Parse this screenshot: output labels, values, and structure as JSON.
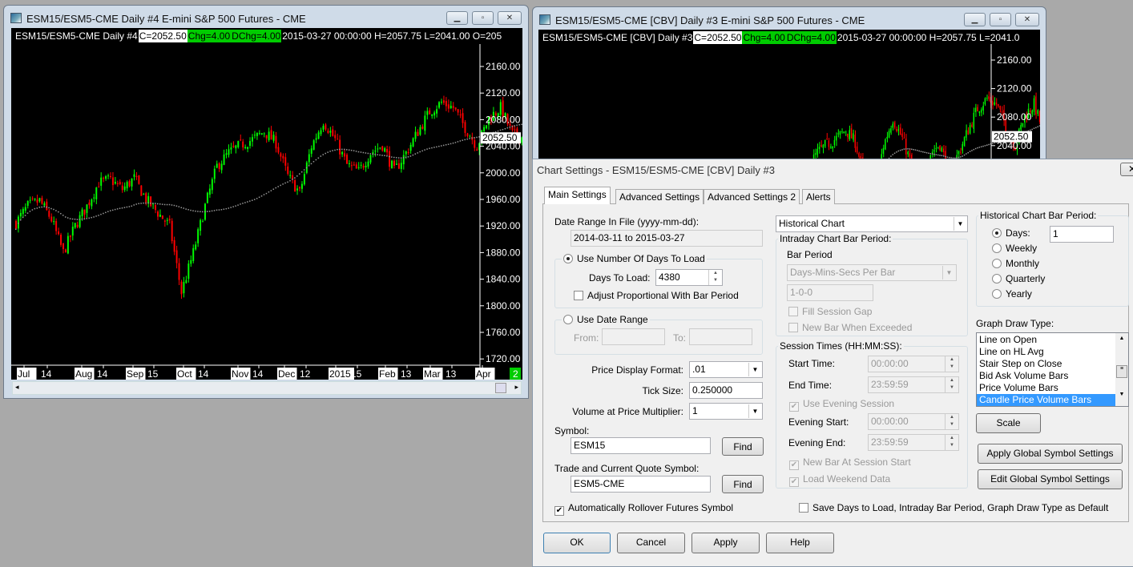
{
  "left_window": {
    "title": "ESM15/ESM5-CME  Daily  #4  E-mini S&P 500 Futures - CME",
    "header": {
      "symbol": "ESM15/ESM5-CME  Daily  #4",
      "close": "C=2052.50",
      "chg": "Chg=4.00",
      "dchg": "DChg=4.00",
      "rest": "2015-03-27 00:00:00 H=2057.75 L=2041.00 O=205"
    },
    "y_ticks": [
      "2160.00",
      "2120.00",
      "2080.00",
      "2040.00",
      "2000.00",
      "1960.00",
      "1920.00",
      "1880.00",
      "1840.00",
      "1800.00",
      "1760.00",
      "1720.00"
    ],
    "last_price": "2052.50",
    "x_ticks": [
      "Jul",
      "14",
      "Aug",
      "14",
      "Sep",
      "15",
      "Oct",
      "14",
      "Nov",
      "14",
      "Dec",
      "12",
      "2015",
      "15",
      "Feb",
      "13",
      "Mar",
      "13",
      "Apr"
    ],
    "corner_badge": "2"
  },
  "right_window": {
    "title": "ESM15/ESM5-CME [CBV]  Daily  #3  E-mini S&P 500 Futures - CME",
    "header": {
      "symbol": "ESM15/ESM5-CME [CBV]  Daily  #3",
      "close": "C=2052.50",
      "chg": "Chg=4.00",
      "dchg": "DChg=4.00",
      "rest": "2015-03-27 00:00:00 H=2057.75 L=2041.0"
    },
    "y_ticks": [
      "2160.00",
      "2120.00",
      "2080.00",
      "2040.00"
    ],
    "last_price": "2052.50"
  },
  "chart_data": {
    "type": "candlestick",
    "title": "ESM15/ESM5-CME Daily",
    "x_range": [
      "2014-07-01",
      "2015-03-27"
    ],
    "ylim": [
      1700,
      2180
    ],
    "weekly_closes": [
      1925,
      1950,
      1958,
      1930,
      1880,
      1920,
      1950,
      1985,
      1990,
      1975,
      1992,
      1960,
      1940,
      1920,
      1820,
      1880,
      1950,
      2010,
      2030,
      2042,
      2050,
      2062,
      2045,
      1995,
      1970,
      2040,
      2078,
      2050,
      2012,
      2002,
      2030,
      2042,
      2002,
      2030,
      2062,
      2092,
      2106,
      2098,
      2068,
      2040,
      2082,
      2098,
      2058,
      2052.5
    ],
    "colors": {
      "up": "#00ff00",
      "down": "#ff0000",
      "ma": "#999999"
    }
  },
  "dialog": {
    "title": "Chart Settings - ESM15/ESM5-CME [CBV]  Daily  #3",
    "tabs": [
      "Main Settings",
      "Advanced Settings",
      "Advanced Settings 2",
      "Alerts"
    ],
    "date_range_label": "Date Range In File (yyyy-mm-dd):",
    "date_range_value": "2014-03-11 to 2015-03-27",
    "use_days": "Use Number Of Days To Load",
    "days_label": "Days To Load:",
    "days_value": "4380",
    "adjust": "Adjust Proportional With Bar Period",
    "use_date_range": "Use Date Range",
    "from": "From:",
    "to": "To:",
    "price_format_label": "Price Display Format:",
    "price_format": ".01",
    "tick_size_label": "Tick Size:",
    "tick_size": "0.250000",
    "vap_label": "Volume at Price Multiplier:",
    "vap": "1",
    "symbol_label": "Symbol:",
    "symbol": "ESM15",
    "find": "Find",
    "quote_label": "Trade and Current Quote Symbol:",
    "quote": "ESM5-CME",
    "rollover": "Automatically Rollover Futures Symbol",
    "chart_type": "Historical Chart",
    "intraday_group": "Intraday Chart Bar Period:",
    "bar_period": "Bar Period",
    "bar_period_type": "Days-Mins-Secs Per Bar",
    "bar_period_value": "1-0-0",
    "fill_gap": "Fill Session Gap",
    "new_bar_exceeded": "New Bar When Exceeded",
    "session_group": "Session Times (HH:MM:SS):",
    "start_time_label": "Start Time:",
    "start_time": "00:00:00",
    "end_time_label": "End Time:",
    "end_time": "23:59:59",
    "use_evening": "Use Evening Session",
    "evening_start_label": "Evening Start:",
    "evening_start": "00:00:00",
    "evening_end_label": "Evening End:",
    "evening_end": "23:59:59",
    "new_bar_session": "New Bar At Session Start",
    "load_weekend": "Load Weekend Data",
    "hist_group": "Historical Chart Bar Period:",
    "periods": [
      "Days:",
      "Weekly",
      "Monthly",
      "Quarterly",
      "Yearly"
    ],
    "days_period": "1",
    "draw_type_label": "Graph Draw Type:",
    "draw_types": [
      "Line on Open",
      "Line on HL Avg",
      "Stair Step on Close",
      "Bid Ask Volume Bars",
      "Price Volume Bars",
      "Candle Price Volume Bars"
    ],
    "scale": "Scale",
    "apply_global": "Apply Global Symbol Settings",
    "edit_global": "Edit Global Symbol Settings",
    "save_default": "Save Days to Load, Intraday Bar Period, Graph Draw Type as Default",
    "ok": "OK",
    "cancel": "Cancel",
    "apply": "Apply",
    "help": "Help"
  }
}
